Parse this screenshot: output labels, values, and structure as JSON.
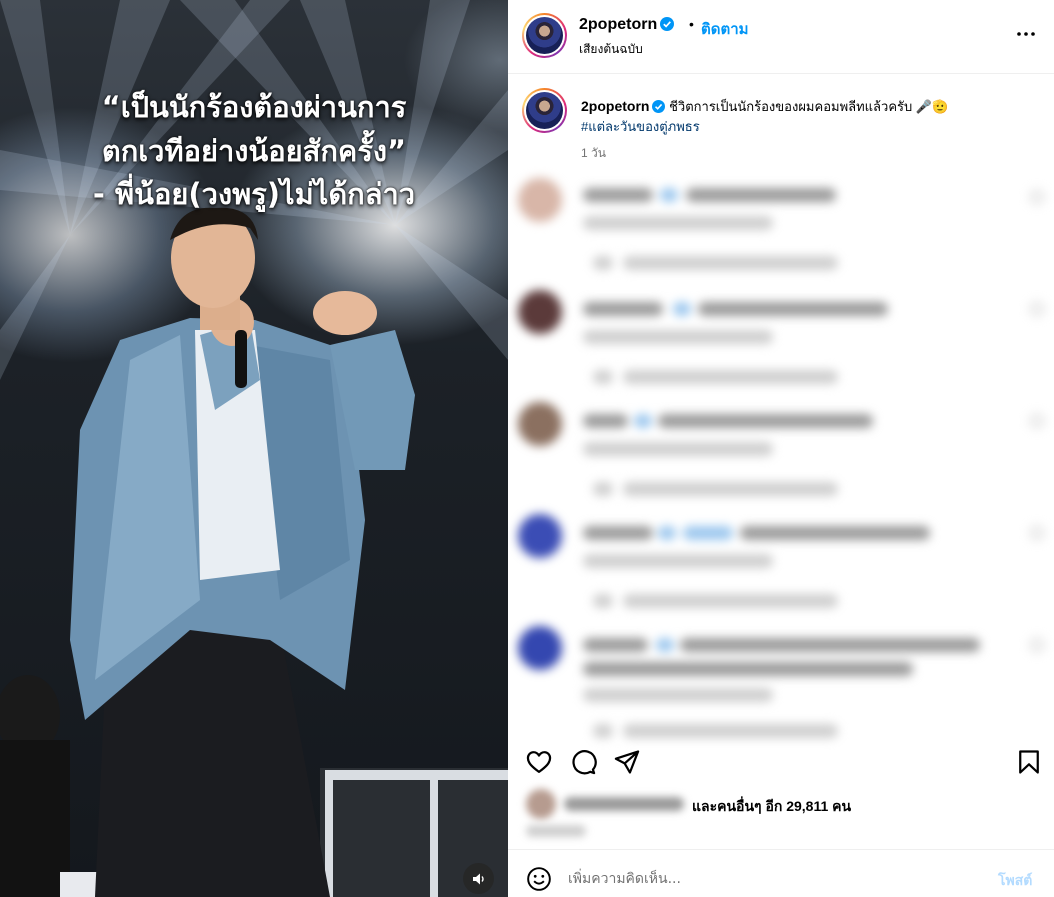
{
  "video": {
    "quote_lines": [
      "“เป็นนักร้องต้องผ่านการ",
      "ตกเวทีอย่างน้อยสักครั้ง”",
      "- พี่น้อย(วงพรู)ไม่ได้กล่าว"
    ],
    "mute_icon": "speaker-icon"
  },
  "header": {
    "username": "2popetorn",
    "separator": "•",
    "follow_label": "ติดตาม",
    "audio_label": "เสียงต้นฉบับ",
    "more_icon": "more-options-icon"
  },
  "caption": {
    "username": "2popetorn",
    "text": "ชีวิตการเป็นนักร้องของผมคอมพลีทแล้วครับ 🎤🫡",
    "hashtag": "#แต่ละวันของตู่ภพธร",
    "time": "1 วัน"
  },
  "actions": {
    "like_icon": "heart-icon",
    "comment_icon": "comment-icon",
    "share_icon": "send-icon",
    "save_icon": "bookmark-icon"
  },
  "likes": {
    "text": "และคนอื่นๆ อีก 29,811 คน"
  },
  "add_comment": {
    "placeholder": "เพิ่มความคิดเห็น...",
    "post_label": "โพสต์",
    "emoji_icon": "emoji-icon"
  },
  "colors": {
    "accent": "#0095f6",
    "hashtag": "#00376b",
    "muted": "#737373"
  }
}
